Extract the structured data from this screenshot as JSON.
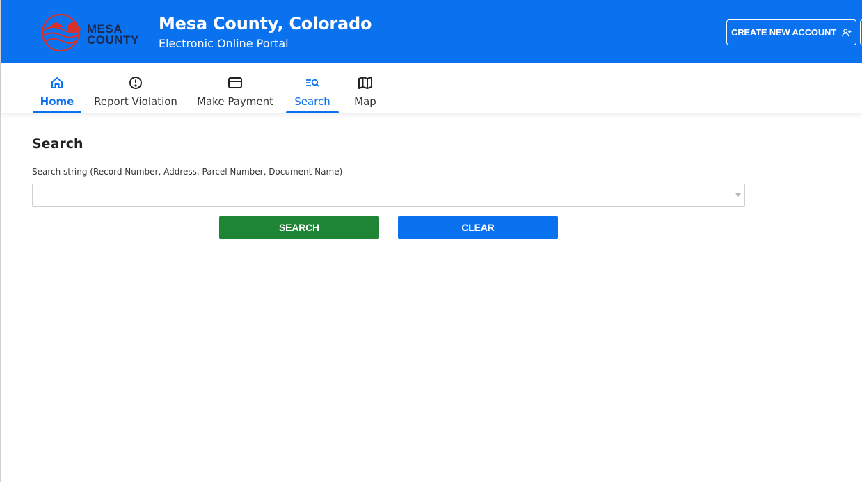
{
  "header": {
    "logo_line1": "MESA",
    "logo_line2": "COUNTY",
    "title": "Mesa County, Colorado",
    "subtitle": "Electronic Online Portal",
    "create_account_label": "CREATE NEW ACCOUNT",
    "create_account_icon": "person-add-icon"
  },
  "nav": {
    "items": [
      {
        "label": "Home",
        "icon": "home-icon",
        "active": true
      },
      {
        "label": "Report Violation",
        "icon": "alert-circle-icon",
        "active": false
      },
      {
        "label": "Make Payment",
        "icon": "credit-card-icon",
        "active": false
      },
      {
        "label": "Search",
        "icon": "search-list-icon",
        "active": true
      },
      {
        "label": "Map",
        "icon": "map-icon",
        "active": false
      }
    ]
  },
  "main": {
    "title": "Search",
    "field_label": "Search string (Record Number, Address, Parcel Number, Document Name)",
    "search_value": "",
    "search_button_label": "SEARCH",
    "clear_button_label": "CLEAR"
  },
  "colors": {
    "primary": "#0a72ef",
    "search_button": "#1e8534",
    "logo_red": "#d6322b",
    "logo_navy": "#1d2a4d"
  }
}
